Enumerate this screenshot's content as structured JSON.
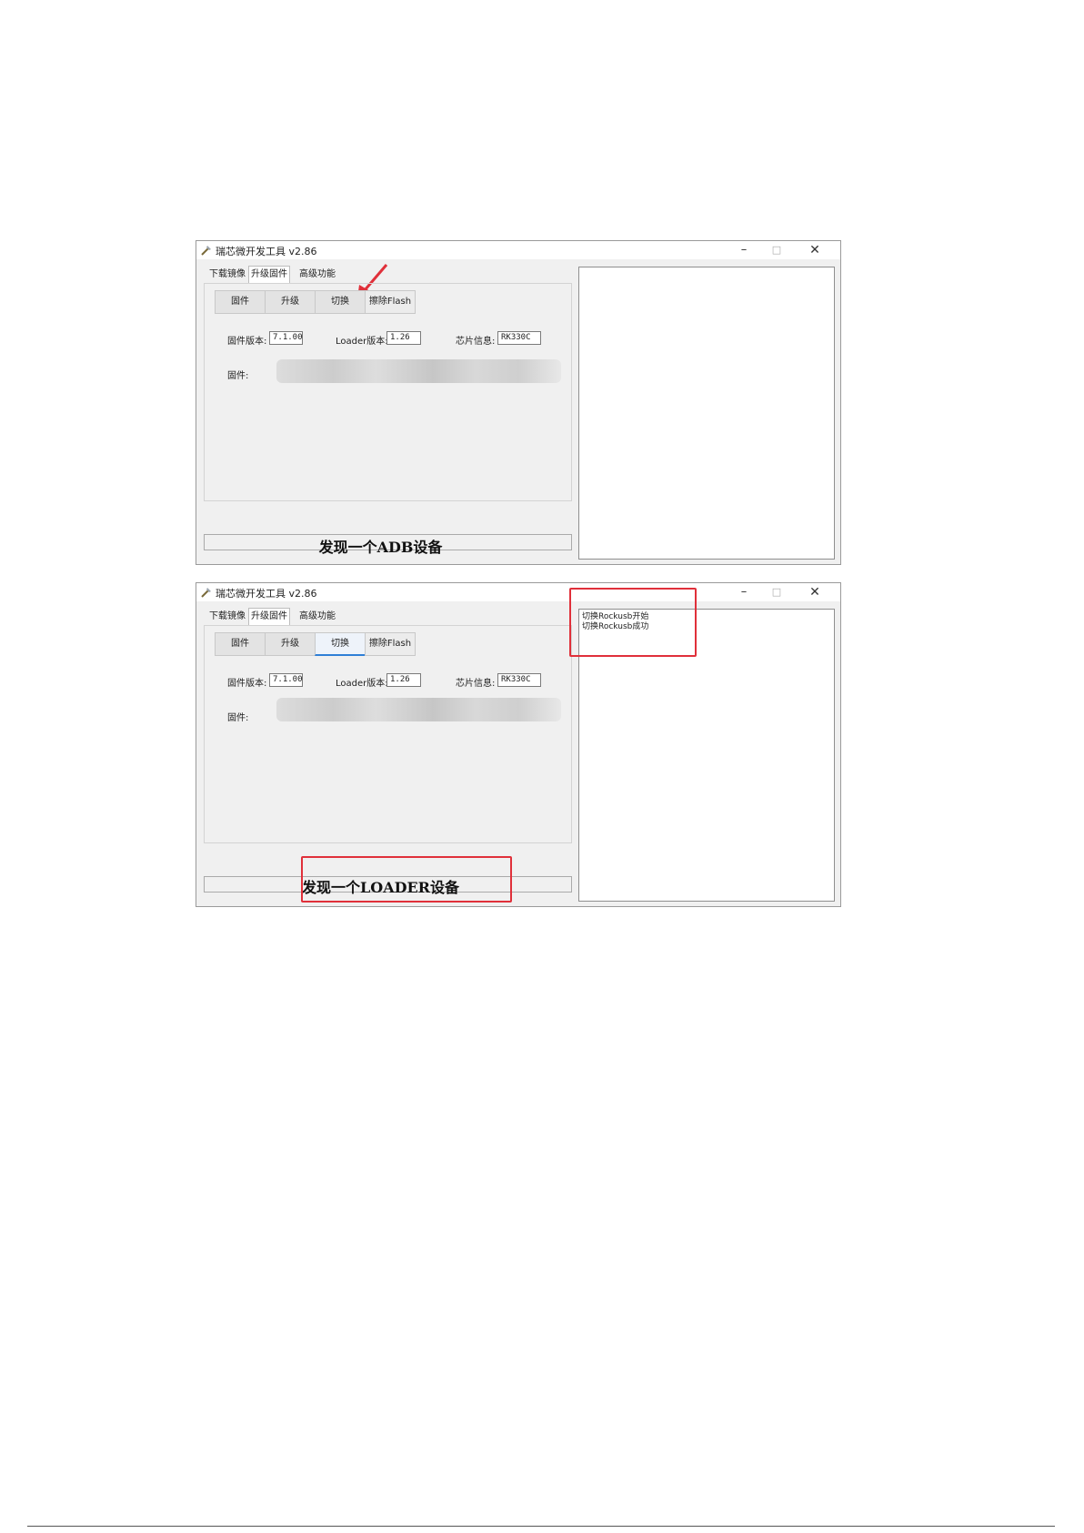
{
  "app": {
    "title": "瑞芯微开发工具 v2.86",
    "min_glyph": "–",
    "max_glyph": "□",
    "close_glyph": "✕"
  },
  "tabs": [
    "下载镜像",
    "升级固件",
    "高级功能"
  ],
  "buttons": [
    "固件",
    "升级",
    "切换",
    "擦除Flash"
  ],
  "fields": {
    "fw_version_label": "固件版本:",
    "fw_version_value": "7.1.00",
    "loader_version_label": "Loader版本:",
    "loader_version_value": "1.26",
    "chip_info_label": "芯片信息:",
    "chip_info_value": "RK330C",
    "firmware_label": "固件:"
  },
  "screens": [
    {
      "status": "发现一个ADB设备",
      "log": []
    },
    {
      "status": "发现一个LOADER设备",
      "log": [
        "切换Rockusb开始",
        "切换Rockusb成功"
      ]
    }
  ],
  "colors": {
    "highlight": "#e0303a",
    "selected_tab": "#2f7fd6"
  }
}
